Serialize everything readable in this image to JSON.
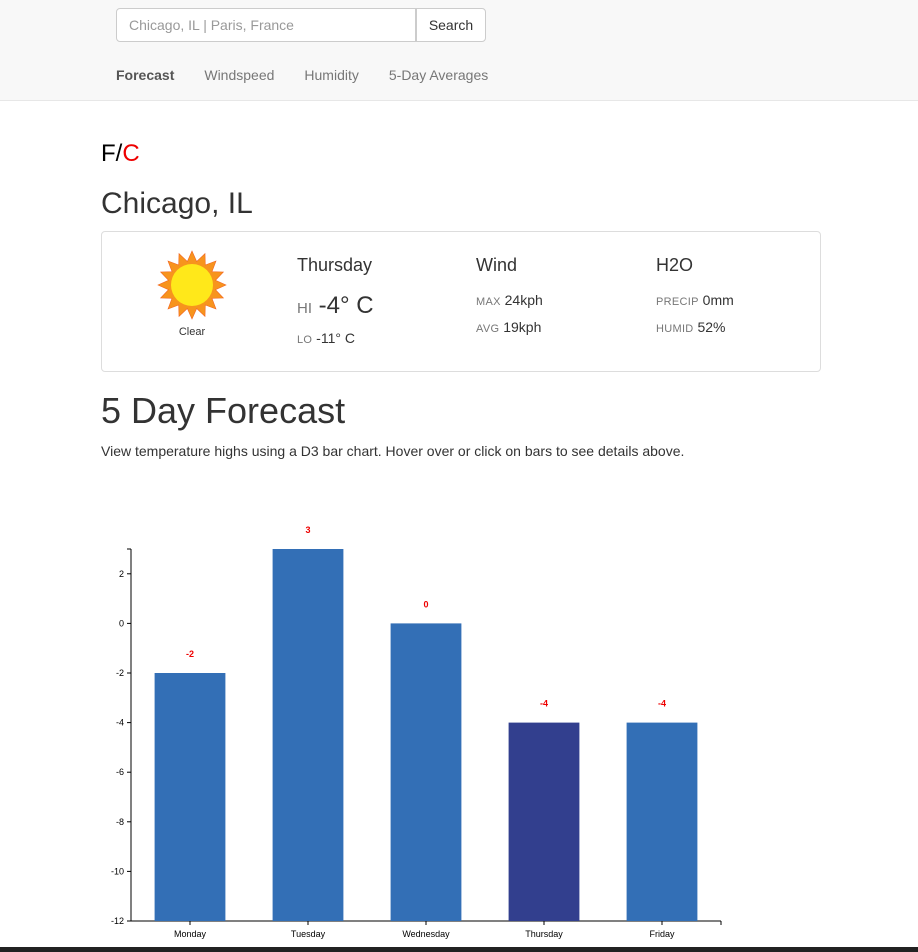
{
  "search": {
    "placeholder": "Chicago, IL | Paris, France",
    "button_label": "Search"
  },
  "nav": {
    "items": [
      {
        "label": "Forecast",
        "active": true
      },
      {
        "label": "Windspeed"
      },
      {
        "label": "Humidity"
      },
      {
        "label": "5-Day Averages"
      }
    ]
  },
  "units": {
    "f": "F",
    "sep": "/",
    "c": "C"
  },
  "location": {
    "name": "Chicago, IL"
  },
  "current": {
    "icon": "sun-icon",
    "condition": "Clear",
    "day": "Thursday",
    "hi_label": "HI",
    "hi_value": "-4° C",
    "lo_label": "LO",
    "lo_value": "-11° C",
    "wind": {
      "title": "Wind",
      "max_label": "MAX",
      "max_value": "24kph",
      "avg_label": "AVG",
      "avg_value": "19kph"
    },
    "h2o": {
      "title": "H2O",
      "precip_label": "PRECIP",
      "precip_value": "0mm",
      "humid_label": "HUMID",
      "humid_value": "52%"
    }
  },
  "forecast_section": {
    "title": "5 Day Forecast",
    "description": "View temperature highs using a D3 bar chart. Hover over or click on bars to see details above."
  },
  "colors": {
    "bar": "#336fb6",
    "bar_selected": "#323f8e",
    "label": "#e00000"
  },
  "chart_data": {
    "type": "bar",
    "categories": [
      "Monday",
      "Tuesday",
      "Wednesday",
      "Thursday",
      "Friday"
    ],
    "values": [
      -2,
      3,
      0,
      -4,
      -4
    ],
    "selected": "Thursday",
    "ylim": [
      -12,
      3
    ],
    "yticks": [
      -12,
      -10,
      -8,
      -6,
      -4,
      -2,
      0,
      2
    ],
    "grid": false
  }
}
